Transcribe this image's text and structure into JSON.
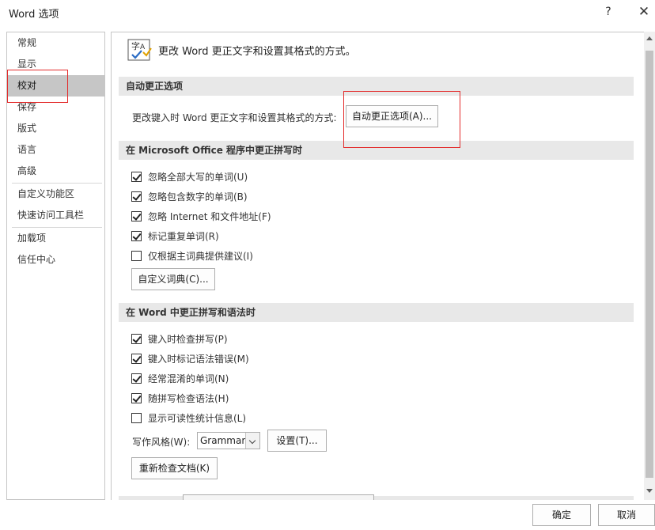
{
  "window": {
    "title": "Word 选项",
    "help": "?",
    "close": "✕"
  },
  "sidebar": {
    "items": [
      {
        "label": "常规"
      },
      {
        "label": "显示"
      },
      {
        "label": "校对"
      },
      {
        "label": "保存"
      },
      {
        "label": "版式"
      },
      {
        "label": "语言"
      },
      {
        "label": "高级"
      },
      {
        "label": "自定义功能区"
      },
      {
        "label": "快速访问工具栏"
      },
      {
        "label": "加载项"
      },
      {
        "label": "信任中心"
      }
    ],
    "selected": "校对"
  },
  "header": {
    "text": "更改 Word 更正文字和设置其格式的方式。",
    "icon": "abc-proofing-icon"
  },
  "autocorrect": {
    "section_title": "自动更正选项",
    "desc": "更改键入时 Word 更正文字和设置其格式的方式:",
    "button": "自动更正选项(A)..."
  },
  "office_spelling": {
    "section_title": "在 Microsoft Office 程序中更正拼写时",
    "options": [
      {
        "label": "忽略全部大写的单词(U)",
        "checked": true
      },
      {
        "label": "忽略包含数字的单词(B)",
        "checked": true
      },
      {
        "label": "忽略 Internet 和文件地址(F)",
        "checked": true
      },
      {
        "label": "标记重复单词(R)",
        "checked": true
      },
      {
        "label": "仅根据主词典提供建议(I)",
        "checked": false
      }
    ],
    "dict_button": "自定义词典(C)..."
  },
  "word_spelling": {
    "section_title": "在 Word 中更正拼写和语法时",
    "options": [
      {
        "label": "键入时检查拼写(P)",
        "checked": true
      },
      {
        "label": "键入时标记语法错误(M)",
        "checked": true
      },
      {
        "label": "经常混淆的单词(N)",
        "checked": true
      },
      {
        "label": "随拼写检查语法(H)",
        "checked": true
      },
      {
        "label": "显示可读性统计信息(L)",
        "checked": false
      }
    ],
    "writing_style_label": "写作风格(W):",
    "writing_style_value": "Grammar",
    "settings_button": "设置(T)...",
    "recheck_button": "重新检查文档(K)"
  },
  "footer": {
    "ok": "确定",
    "cancel": "取消"
  }
}
